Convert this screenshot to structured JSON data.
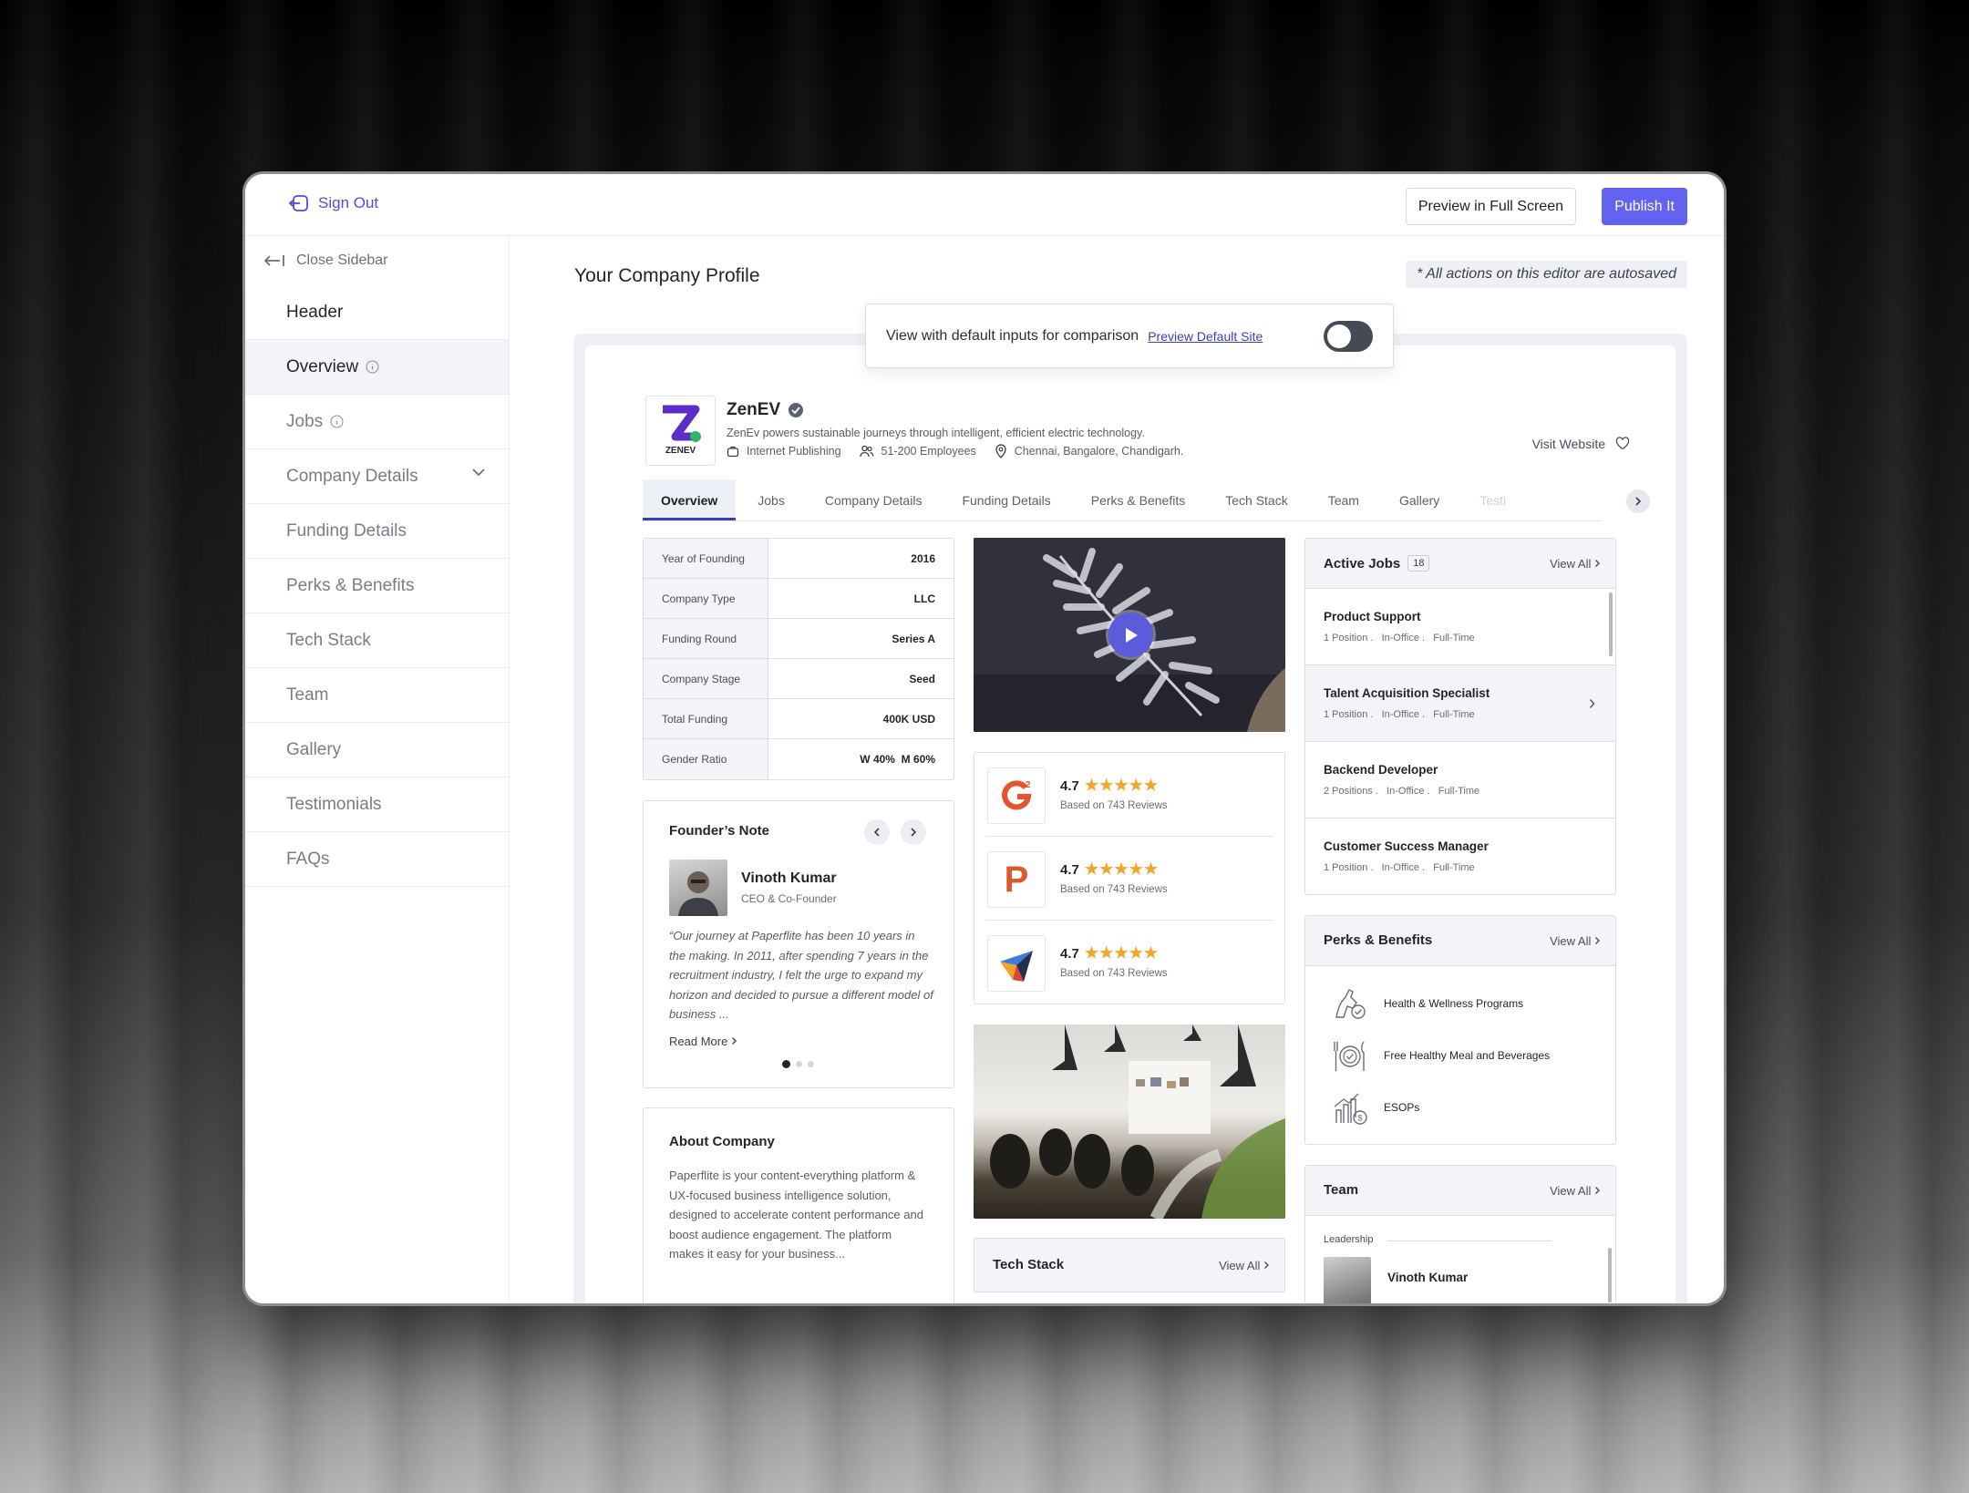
{
  "topbar": {
    "sign_out": "Sign Out",
    "preview": "Preview in Full Screen",
    "publish": "Publish It"
  },
  "sidebar": {
    "close": "Close Sidebar",
    "items": [
      "Header",
      "Overview",
      "Jobs",
      "Company Details",
      "Funding Details",
      "Perks & Benefits",
      "Tech Stack",
      "Team",
      "Gallery",
      "Testimonials",
      "FAQs"
    ]
  },
  "page": {
    "title": "Your Company Profile",
    "autosave": "* All actions on this editor are autosaved"
  },
  "compare": {
    "label": "View with default inputs for comparison",
    "link": "Preview Default Site",
    "toggle_on": false
  },
  "company": {
    "logo_text": "ZENEV",
    "name": "ZenEV",
    "description": "ZenEv powers sustainable journeys through intelligent, efficient electric technology.",
    "industry": "Internet Publishing",
    "size": "51-200 Employees",
    "locations": "Chennai, Bangalore, Chandigarh.",
    "visit": "Visit Website"
  },
  "tabs": [
    "Overview",
    "Jobs",
    "Company Details",
    "Funding Details",
    "Perks & Benefits",
    "Tech Stack",
    "Team",
    "Gallery",
    "Testi"
  ],
  "facts": [
    {
      "k": "Year of Founding",
      "v": "2016"
    },
    {
      "k": "Company Type",
      "v": "LLC"
    },
    {
      "k": "Funding Round",
      "v": "Series A"
    },
    {
      "k": "Company Stage",
      "v": "Seed"
    },
    {
      "k": "Total Funding",
      "v": "400K USD"
    },
    {
      "k": "Gender Ratio",
      "v": "W 40%  M 60%"
    }
  ],
  "founder": {
    "heading": "Founder’s Note",
    "name": "Vinoth Kumar",
    "role": "CEO & Co-Founder",
    "quote": "“Our journey at Paperflite has been 10 years in the making. In 2011, after spending 7 years in the recruitment industry, I felt the urge to expand my horizon and decided to pursue a different model of business ...",
    "more": "Read More"
  },
  "about": {
    "heading": "About Company",
    "text": "Paperflite is your content-everything platform & UX-focused business intelligence solution, designed to accelerate content performance and boost audience engagement. The platform makes it easy for your business..."
  },
  "reviews": [
    {
      "site": "G2",
      "score": "4.7",
      "stars": "★★★★★",
      "basis": "Based on 743 Reviews",
      "color": "#e8532f"
    },
    {
      "site": "P",
      "score": "4.7",
      "stars": "★★★★★",
      "basis": "Based on 743 Reviews",
      "color": "#da5a2c"
    },
    {
      "site": "Capterra",
      "score": "4.7",
      "stars": "★★★★★",
      "basis": "Based on 743 Reviews",
      "color": "#3b7dd8"
    }
  ],
  "tech": {
    "heading": "Tech Stack",
    "view_all": "View All"
  },
  "jobs": {
    "heading": "Active Jobs",
    "count": "18",
    "view_all": "View All",
    "items": [
      {
        "title": "Product Support",
        "meta": "1 Position .   In-Office .   Full-Time"
      },
      {
        "title": "Talent Acquisition Specialist",
        "meta": "1 Position .   In-Office .   Full-Time"
      },
      {
        "title": "Backend Developer",
        "meta": "2 Positions .   In-Office .   Full-Time"
      },
      {
        "title": "Customer Success Manager",
        "meta": "1 Position .   In-Office .   Full-Time"
      }
    ]
  },
  "perks": {
    "heading": "Perks & Benefits",
    "view_all": "View All",
    "items": [
      "Health & Wellness Programs",
      "Free Healthy Meal and Beverages",
      "ESOPs"
    ]
  },
  "team": {
    "heading": "Team",
    "view_all": "View All",
    "group": "Leadership",
    "member": "Vinoth Kumar"
  },
  "colors": {
    "accent": "#6462f0",
    "link": "#4b4fd8",
    "star": "#f3a529",
    "logo_purple": "#5b2ec7",
    "logo_green": "#2fb46a"
  }
}
